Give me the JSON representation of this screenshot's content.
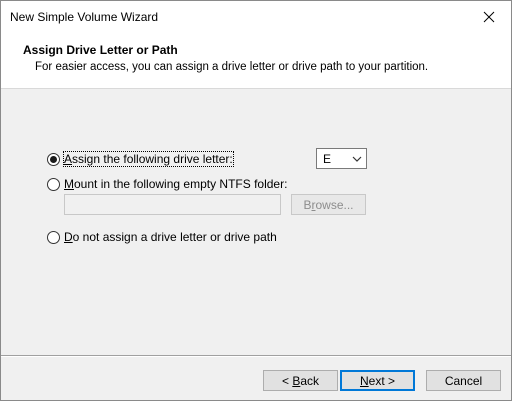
{
  "window": {
    "title": "New Simple Volume Wizard"
  },
  "header": {
    "title": "Assign Drive Letter or Path",
    "subtitle": "For easier access, you can assign a drive letter or drive path to your partition."
  },
  "options": {
    "assign_letter": {
      "prefix": "",
      "accel": "A",
      "rest": "ssign the following drive letter:",
      "selected": true
    },
    "mount_folder": {
      "prefix": "",
      "accel": "M",
      "rest": "ount in the following empty NTFS folder:",
      "selected": false
    },
    "no_assign": {
      "prefix": "",
      "accel": "D",
      "rest": "o not assign a drive letter or drive path",
      "selected": false
    }
  },
  "drive_letter": {
    "value": "E"
  },
  "folder_path": {
    "value": ""
  },
  "buttons": {
    "browse": {
      "accel": "r",
      "pre": "B",
      "post": "owse..."
    },
    "back": {
      "pre": "< ",
      "accel": "B",
      "post": "ack"
    },
    "next": {
      "pre": "",
      "accel": "N",
      "post": "ext >"
    },
    "cancel": {
      "label": "Cancel"
    }
  },
  "colors": {
    "focus_accent": "#0078d7",
    "window_bg": "#f0f0f0"
  }
}
